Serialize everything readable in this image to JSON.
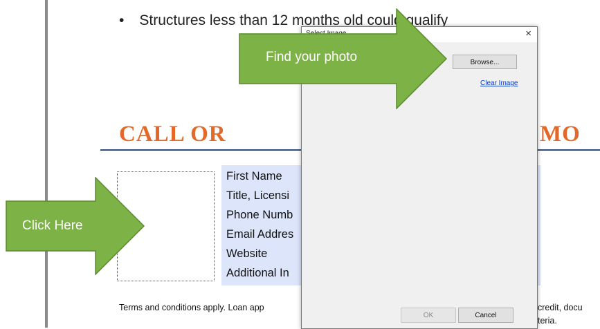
{
  "document": {
    "bullet": "Structures less than 12 months old could qualify",
    "banner_left": "CALL OR",
    "banner_right": "MO",
    "fields": [
      "First Name",
      "Title, Licensi",
      "Phone Numb",
      "Email Addres",
      "Website",
      "Additional In"
    ],
    "terms_left": "Terms and conditions apply. Loan app",
    "terms_right_1": "credit, docu",
    "terms_right_2": "teria."
  },
  "dialog": {
    "title": "Select Image",
    "close": "×",
    "browse": "Browse...",
    "clear": "Clear Image",
    "ok": "OK",
    "cancel": "Cancel"
  },
  "callouts": {
    "top": "Find your photo",
    "left": "Click Here"
  },
  "colors": {
    "banner": "#e2692a",
    "field_bg": "#dde5fb",
    "arrow_fill": "#7db346",
    "arrow_stroke": "#5a8a2e",
    "link": "#0a3cc8"
  }
}
